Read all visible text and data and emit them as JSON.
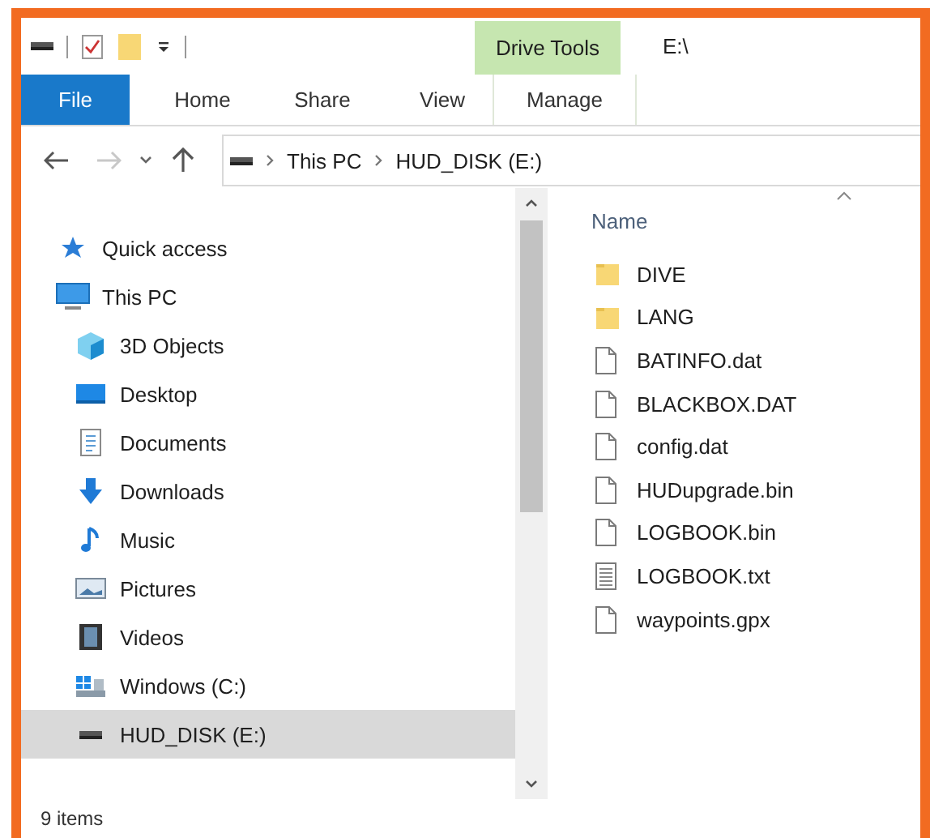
{
  "title_bar": {
    "contextual_tab": "Drive Tools",
    "title": "E:\\"
  },
  "ribbon_tabs": [
    {
      "label": "File",
      "kind": "file"
    },
    {
      "label": "Home",
      "kind": "tab"
    },
    {
      "label": "Share",
      "kind": "tab"
    },
    {
      "label": "View",
      "kind": "tab"
    },
    {
      "label": "Manage",
      "kind": "contextual"
    }
  ],
  "address_bar": {
    "forward_disabled": true,
    "path": [
      "This PC",
      "HUD_DISK (E:)"
    ]
  },
  "navigation_pane": {
    "items": [
      {
        "label": "Quick access",
        "kind": "star",
        "selected": false
      },
      {
        "label": "This PC",
        "kind": "computer",
        "selected": false,
        "children": [
          {
            "label": "3D Objects",
            "kind": "cube",
            "selected": false
          },
          {
            "label": "Desktop",
            "kind": "desktop",
            "selected": false
          },
          {
            "label": "Documents",
            "kind": "documents",
            "selected": false
          },
          {
            "label": "Downloads",
            "kind": "downloads",
            "selected": false
          },
          {
            "label": "Music",
            "kind": "music",
            "selected": false
          },
          {
            "label": "Pictures",
            "kind": "pictures",
            "selected": false
          },
          {
            "label": "Videos",
            "kind": "videos",
            "selected": false
          },
          {
            "label": "Windows (C:)",
            "kind": "system-drive",
            "selected": false
          },
          {
            "label": "HUD_DISK (E:)",
            "kind": "drive",
            "selected": true
          }
        ]
      }
    ]
  },
  "file_list": {
    "column": "Name",
    "files": [
      {
        "name": "DIVE",
        "kind": "folder"
      },
      {
        "name": "LANG",
        "kind": "folder"
      },
      {
        "name": "BATINFO.dat",
        "kind": "file"
      },
      {
        "name": "BLACKBOX.DAT",
        "kind": "file"
      },
      {
        "name": "config.dat",
        "kind": "file"
      },
      {
        "name": "HUDupgrade.bin",
        "kind": "file"
      },
      {
        "name": "LOGBOOK.bin",
        "kind": "file"
      },
      {
        "name": "LOGBOOK.txt",
        "kind": "text"
      },
      {
        "name": "waypoints.gpx",
        "kind": "file"
      }
    ]
  },
  "status_bar": {
    "items": "9 items"
  }
}
